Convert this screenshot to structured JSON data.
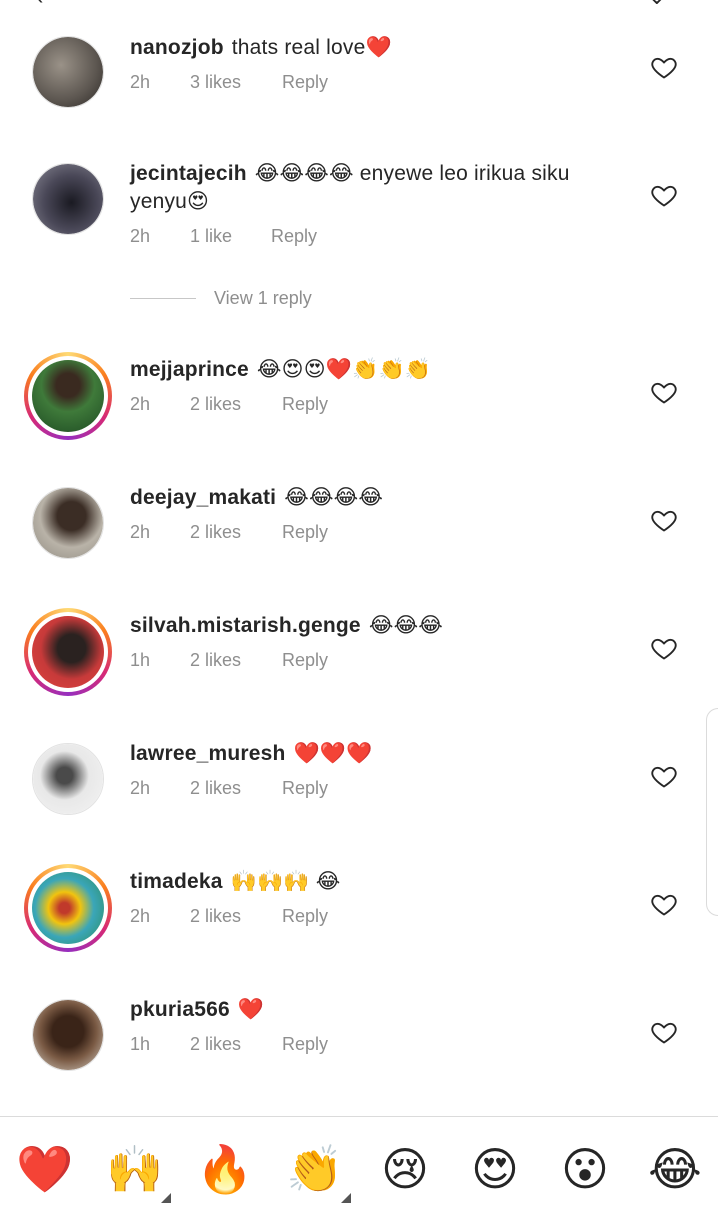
{
  "header": {
    "back_glyph": "‹",
    "menu_glyph": "⌄"
  },
  "comments": [
    {
      "username": "nanozjob",
      "text": "thats real love❤️",
      "time": "2h",
      "likes": "3 likes",
      "reply": "Reply"
    },
    {
      "username": "jecintajecih",
      "text": "😂😂😂😂 enyewe leo irikua siku yenyu😍",
      "time": "2h",
      "likes": "1 like",
      "reply": "Reply",
      "view_replies": "View 1 reply"
    },
    {
      "username": "mejjaprince",
      "text": "😂😍😍❤️👏👏👏",
      "time": "2h",
      "likes": "2 likes",
      "reply": "Reply"
    },
    {
      "username": "deejay_makati",
      "text": "😂😂😂😂",
      "time": "2h",
      "likes": "2 likes",
      "reply": "Reply"
    },
    {
      "username": "silvah.mistarish.genge",
      "text": "😂😂😂",
      "time": "1h",
      "likes": "2 likes",
      "reply": "Reply"
    },
    {
      "username": "lawree_muresh",
      "text": "❤️❤️❤️",
      "time": "2h",
      "likes": "2 likes",
      "reply": "Reply"
    },
    {
      "username": "timadeka",
      "text": "🙌🙌🙌 😂",
      "time": "2h",
      "likes": "2 likes",
      "reply": "Reply"
    },
    {
      "username": "pkuria566",
      "text": "❤️",
      "time": "1h",
      "likes": "2 likes",
      "reply": "Reply"
    }
  ],
  "reactions": [
    "❤️",
    "🙌",
    "🔥",
    "👏",
    "😢",
    "😍",
    "😮",
    "😂"
  ],
  "colors": {
    "text": "#262626",
    "secondary": "#8e8e8e",
    "divider": "#dbdbdb"
  },
  "icons": {
    "like": "heart-outline-icon"
  }
}
